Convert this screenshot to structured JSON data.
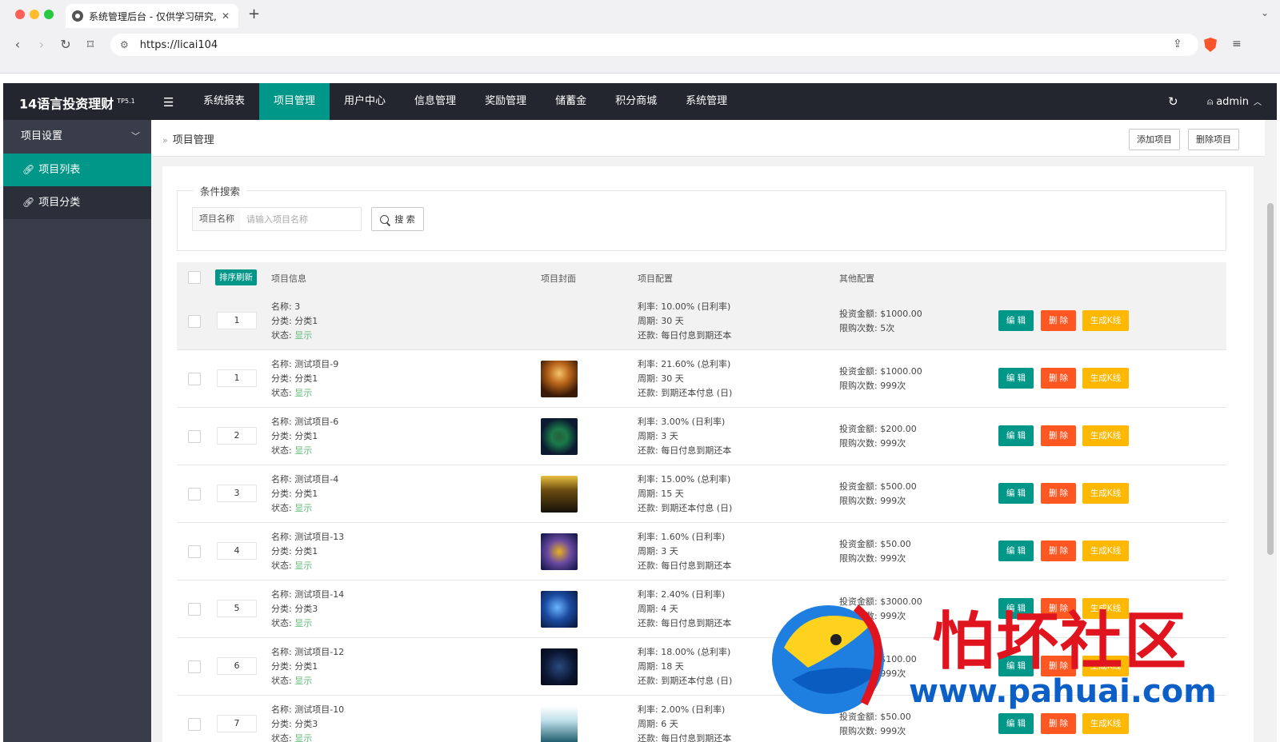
{
  "browser": {
    "tab_title": "系统管理后台 - 仅供学习研究,",
    "url": "https://licai104"
  },
  "app": {
    "logo": "14语言投资理财",
    "version": "TP5.1",
    "nav": [
      "系统报表",
      "项目管理",
      "用户中心",
      "信息管理",
      "奖励管理",
      "储蓄金",
      "积分商城",
      "系统管理"
    ],
    "active_nav": "项目管理",
    "user": "admin"
  },
  "sidebar": {
    "group": "项目设置",
    "items": [
      {
        "label": "项目列表",
        "active": true
      },
      {
        "label": "项目分类",
        "active": false
      }
    ]
  },
  "breadcrumb": "项目管理",
  "top_buttons": {
    "add": "添加项目",
    "delete": "删除项目"
  },
  "search": {
    "legend": "条件搜索",
    "label": "项目名称",
    "placeholder": "请输入项目名称",
    "button": "搜 索"
  },
  "table": {
    "sort_button": "排序刷新",
    "headers": [
      "项目信息",
      "项目封面",
      "项目配置",
      "其他配置"
    ],
    "labels": {
      "name": "名称:",
      "category": "分类:",
      "status": "状态:",
      "rate": "利率:",
      "period": "周期:",
      "repay": "还款:",
      "amount": "投资金额:",
      "limit": "限购次数:"
    },
    "actions": {
      "edit": "编 辑",
      "delete": "删 除",
      "kline": "生成K线"
    },
    "rows": [
      {
        "order": "1",
        "name": "3",
        "category": "分类1",
        "status": "显示",
        "thumb": "",
        "rate": "10.00% (日利率)",
        "period": "30 天",
        "repay": "每日付息到期还本",
        "amount": "$1000.00",
        "limit": "5次"
      },
      {
        "order": "1",
        "name": "测试项目-9",
        "category": "分类1",
        "status": "显示",
        "thumb": "t1",
        "rate": "21.60% (总利率)",
        "period": "30 天",
        "repay": "到期还本付息 (日)",
        "amount": "$1000.00",
        "limit": "999次"
      },
      {
        "order": "2",
        "name": "测试项目-6",
        "category": "分类1",
        "status": "显示",
        "thumb": "t2",
        "rate": "3.00% (日利率)",
        "period": "3 天",
        "repay": "每日付息到期还本",
        "amount": "$200.00",
        "limit": "999次"
      },
      {
        "order": "3",
        "name": "测试项目-4",
        "category": "分类1",
        "status": "显示",
        "thumb": "t3",
        "rate": "15.00% (总利率)",
        "period": "15 天",
        "repay": "到期还本付息 (日)",
        "amount": "$500.00",
        "limit": "999次"
      },
      {
        "order": "4",
        "name": "测试项目-13",
        "category": "分类1",
        "status": "显示",
        "thumb": "t4",
        "rate": "1.60% (日利率)",
        "period": "3 天",
        "repay": "每日付息到期还本",
        "amount": "$50.00",
        "limit": "999次"
      },
      {
        "order": "5",
        "name": "测试项目-14",
        "category": "分类3",
        "status": "显示",
        "thumb": "t5",
        "rate": "2.40% (日利率)",
        "period": "4 天",
        "repay": "每日付息到期还本",
        "amount": "$3000.00",
        "limit": "999次"
      },
      {
        "order": "6",
        "name": "测试项目-12",
        "category": "分类1",
        "status": "显示",
        "thumb": "t6",
        "rate": "18.00% (总利率)",
        "period": "18 天",
        "repay": "到期还本付息 (日)",
        "amount": "$100.00",
        "limit": "999次"
      },
      {
        "order": "7",
        "name": "测试项目-10",
        "category": "分类3",
        "status": "显示",
        "thumb": "t7",
        "rate": "2.00% (日利率)",
        "period": "6 天",
        "repay": "每日付息到期还本",
        "amount": "$50.00",
        "limit": "999次"
      }
    ]
  },
  "watermark": {
    "cn": "怕坏社区",
    "url": "www.pahuai.com"
  }
}
